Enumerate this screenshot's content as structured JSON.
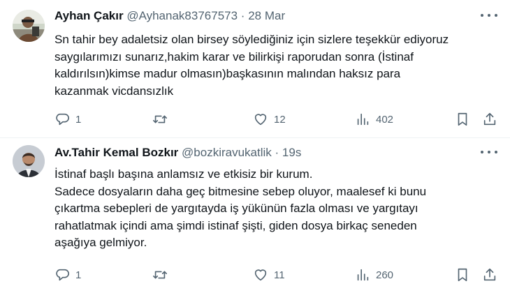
{
  "tweets": [
    {
      "display_name": "Ayhan Çakır",
      "handle": "@Ayhanak83767573",
      "separator": "·",
      "time": "28 Mar",
      "text": "Sn tahir bey adaletsiz olan birsey söylediğiniz için sizlere teşekkür ediyoruz\nsaygılarımızı sunarız,hakim karar ve bilirkişi raporudan sonra (İstinaf\nkaldırılsın)kimse madur olmasın)başkasının malından haksız para\nkazanmak vicdansızlık",
      "replies": "1",
      "retweets": "",
      "likes": "12",
      "views": "402"
    },
    {
      "display_name": "Av.Tahir Kemal Bozkır",
      "handle": "@bozkiravukatlik",
      "separator": "·",
      "time": "19s",
      "text": "İstinaf başlı başına anlamsız ve etkisiz bir kurum.\nSadece dosyaların daha geç bitmesine sebep oluyor, maalesef ki bunu\nçıkartma sebepleri de yargıtayda iş yükünün fazla olması ve yargıtayı\nrahatlatmak içindi ama şimdi istinaf şişti, giden dosya birkaç seneden\naşağıya gelmiyor.",
      "replies": "1",
      "retweets": "",
      "likes": "11",
      "views": "260"
    }
  ],
  "icons": {
    "reply": "reply-icon",
    "retweet": "retweet-icon",
    "like": "heart-icon",
    "views": "views-icon",
    "bookmark": "bookmark-icon",
    "share": "share-icon",
    "more": "more-icon"
  },
  "colors": {
    "text": "#0f1419",
    "secondary": "#536471",
    "divider": "#eff3f4"
  }
}
